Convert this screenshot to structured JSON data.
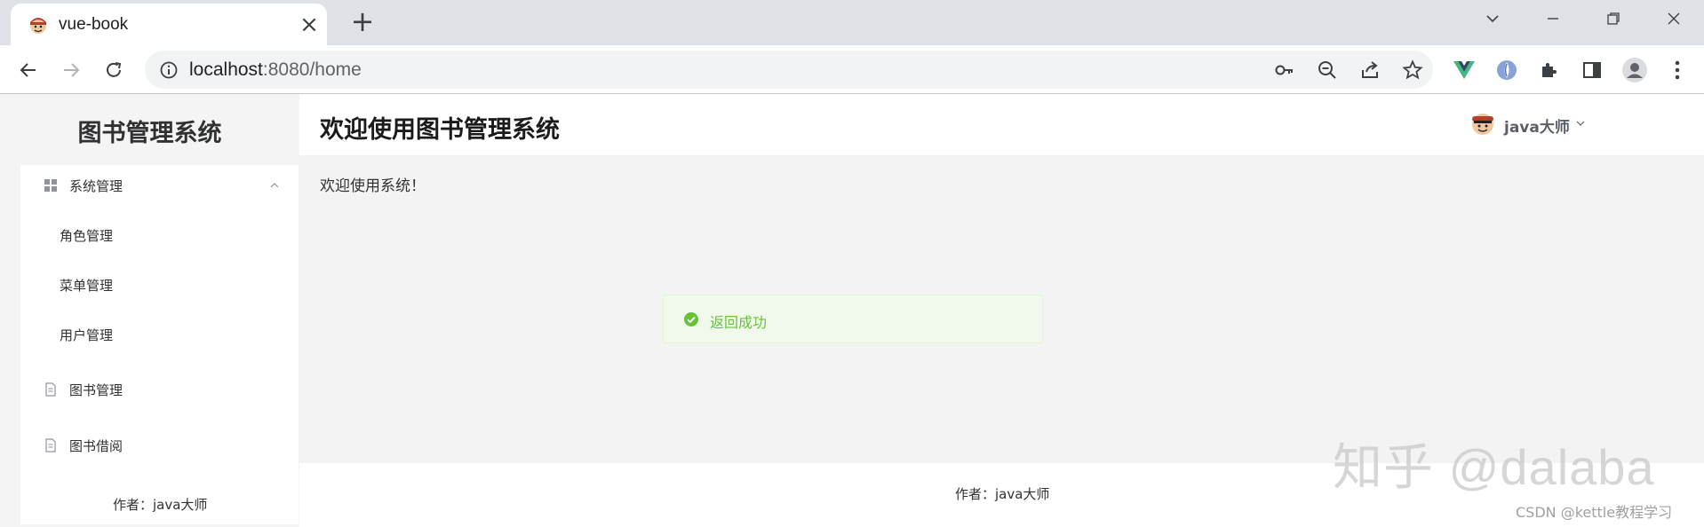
{
  "browser": {
    "tab_title": "vue-book",
    "url_host": "localhost",
    "url_rest": ":8080/home"
  },
  "sidebar": {
    "brand": "图书管理系统",
    "items": [
      {
        "label": "系统管理",
        "icon": "grid-icon"
      },
      {
        "label": "角色管理"
      },
      {
        "label": "菜单管理"
      },
      {
        "label": "用户管理"
      },
      {
        "label": "图书管理",
        "icon": "document-icon"
      },
      {
        "label": "图书借阅",
        "icon": "document-icon"
      }
    ],
    "author": "作者：java大师"
  },
  "header": {
    "title": "欢迎使用图书管理系统",
    "user_name": "java大师"
  },
  "content": {
    "welcome": "欢迎使用系统！"
  },
  "toast": {
    "message": "返回成功",
    "color": "#67c23a"
  },
  "footer": {
    "author": "作者：java大师"
  },
  "watermarks": {
    "big": "知乎 @dalaba",
    "small": "CSDN @kettle教程学习"
  }
}
